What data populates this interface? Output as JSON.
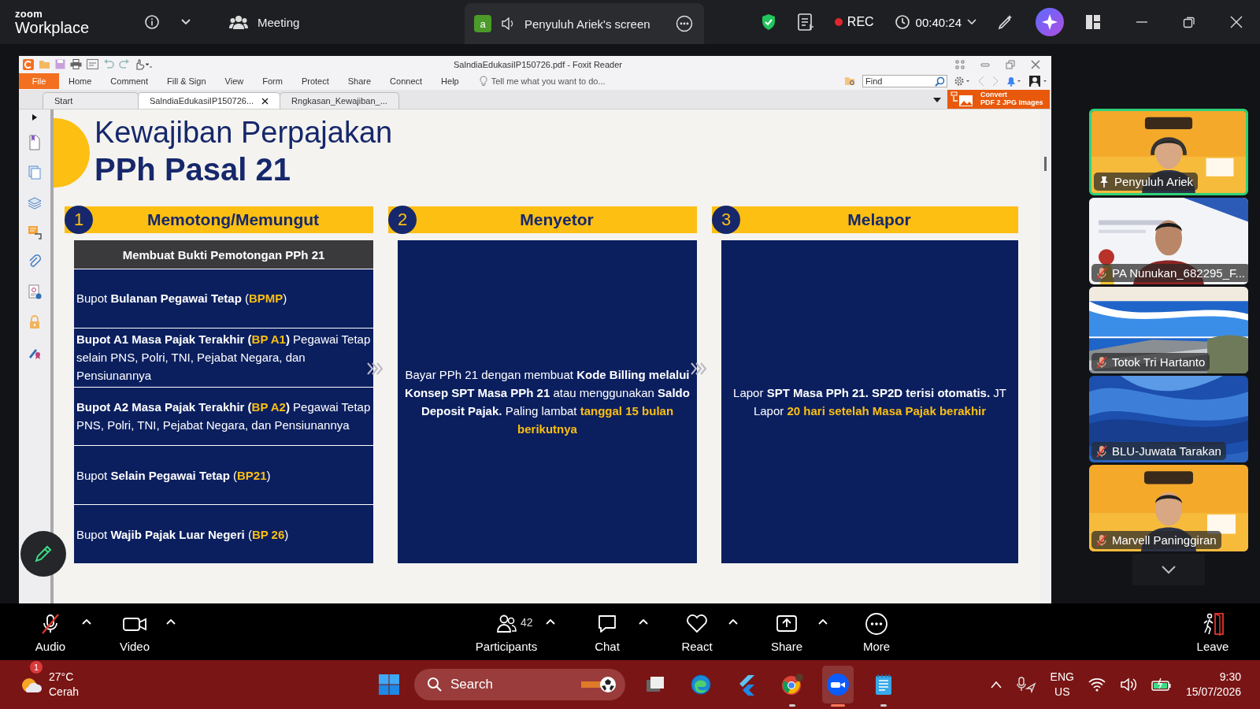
{
  "top_bar": {
    "brand_small": "zoom",
    "brand": "Workplace",
    "meeting_label": "Meeting",
    "share_tab": {
      "avatar": "a",
      "label": "Penyuluh Ariek's screen"
    },
    "rec_label": "REC",
    "timer": "00:40:24"
  },
  "reader": {
    "title": "SalndiaEdukasiIP150726.pdf - Foxit Reader",
    "menu": [
      {
        "label": "File",
        "selected": true
      },
      {
        "label": "Home",
        "selected": false
      },
      {
        "label": "Comment",
        "selected": false
      },
      {
        "label": "Fill & Sign",
        "selected": false
      },
      {
        "label": "View",
        "selected": false
      },
      {
        "label": "Form",
        "selected": false
      },
      {
        "label": "Protect",
        "selected": false
      },
      {
        "label": "Share",
        "selected": false
      },
      {
        "label": "Connect",
        "selected": false
      },
      {
        "label": "Help",
        "selected": false
      }
    ],
    "tell_me": "Tell me what you want to do...",
    "find": {
      "placeholder": "Find"
    },
    "convert": {
      "line1": "Convert",
      "line2": "PDF 2 JPG Images"
    },
    "tabs": [
      {
        "label": "Start",
        "selected": false,
        "closable": false
      },
      {
        "label": "SalndiaEdukasiIP150726...",
        "selected": true,
        "closable": true
      },
      {
        "label": "Rngkasan_Kewajiban_...",
        "selected": false,
        "closable": false
      }
    ]
  },
  "slide": {
    "title": "Kewajiban Perpajakan",
    "subtitle": "PPh Pasal 21",
    "columns": [
      {
        "number": "1",
        "heading": "Memotong/Memungut",
        "subheading": "Membuat Bukti Pemotongan PPh 21",
        "items": [
          [
            {
              "kind": "plain",
              "text": "Bupot "
            },
            {
              "kind": "bold",
              "text": "Bulanan Pegawai Tetap"
            },
            {
              "kind": "plain",
              "text": " ("
            },
            {
              "kind": "highlight",
              "text": "BPMP"
            },
            {
              "kind": "plain",
              "text": ")"
            }
          ],
          [
            {
              "kind": "bold",
              "text": "Bupot A1 Masa Pajak Terakhir ("
            },
            {
              "kind": "highlight",
              "text": "BP A1"
            },
            {
              "kind": "bold",
              "text": ")"
            },
            {
              "kind": "plain",
              "text": " Pegawai Tetap selain PNS, Polri, TNI, Pejabat Negara,  dan Pensiunannya"
            }
          ],
          [
            {
              "kind": "bold",
              "text": "Bupot A2 Masa Pajak Terakhir ("
            },
            {
              "kind": "highlight",
              "text": "BP A2"
            },
            {
              "kind": "bold",
              "text": ")"
            },
            {
              "kind": "plain",
              "text": " Pegawai Tetap PNS, Polri, TNI, Pejabat Negara, dan Pensiunannya"
            }
          ],
          [
            {
              "kind": "plain",
              "text": "Bupot "
            },
            {
              "kind": "bold",
              "text": "Selain Pegawai Tetap"
            },
            {
              "kind": "plain",
              "text": " ("
            },
            {
              "kind": "highlight",
              "text": "BP21"
            },
            {
              "kind": "plain",
              "text": ")"
            }
          ],
          [
            {
              "kind": "plain",
              "text": "Bupot "
            },
            {
              "kind": "bold",
              "text": "Wajib Pajak Luar Negeri"
            },
            {
              "kind": "plain",
              "text": " ("
            },
            {
              "kind": "highlight",
              "text": "BP 26"
            },
            {
              "kind": "plain",
              "text": ")"
            }
          ]
        ]
      },
      {
        "number": "2",
        "heading": "Menyetor",
        "body": [
          {
            "kind": "plain",
            "text": "Bayar PPh 21 dengan membuat "
          },
          {
            "kind": "bold",
            "text": "Kode Billing melalui Konsep SPT Masa PPh 21"
          },
          {
            "kind": "plain",
            "text": " atau menggunakan "
          },
          {
            "kind": "bold",
            "text": "Saldo Deposit Pajak."
          },
          {
            "kind": "plain",
            "text": "  Paling lambat "
          },
          {
            "kind": "highlight",
            "text": "tanggal 15 bulan berikutnya"
          }
        ]
      },
      {
        "number": "3",
        "heading": "Melapor",
        "body": [
          {
            "kind": "plain",
            "text": "Lapor "
          },
          {
            "kind": "bold",
            "text": "SPT Masa PPh 21. SP2D terisi otomatis."
          },
          {
            "kind": "plain",
            "text": " JT Lapor "
          },
          {
            "kind": "highlight",
            "text": "20 hari setelah Masa Pajak berakhir"
          }
        ]
      }
    ]
  },
  "participants": [
    {
      "name": "Penyuluh Ariek",
      "active": true,
      "pinned": true,
      "muted": false
    },
    {
      "name": "PA Nunukan_682295_F...",
      "active": false,
      "pinned": false,
      "muted": true
    },
    {
      "name": "Totok Tri Hartanto",
      "active": false,
      "pinned": false,
      "muted": true
    },
    {
      "name": "BLU-Juwata Tarakan",
      "active": false,
      "pinned": false,
      "muted": true
    },
    {
      "name": "Marvell Paninggiran",
      "active": false,
      "pinned": false,
      "muted": true
    }
  ],
  "toolbar": {
    "buttons": [
      {
        "kind": "audio",
        "label": "Audio",
        "muted": true,
        "caret": true
      },
      {
        "kind": "video",
        "label": "Video",
        "caret": true
      },
      {
        "kind": "participants",
        "label": "Participants",
        "count": "42",
        "caret": true
      },
      {
        "kind": "chat",
        "label": "Chat",
        "caret": true
      },
      {
        "kind": "react",
        "label": "React",
        "caret": true
      },
      {
        "kind": "share",
        "label": "Share",
        "caret": true
      },
      {
        "kind": "more",
        "label": "More",
        "caret": false
      }
    ],
    "leave_label": "Leave"
  },
  "taskbar": {
    "weather": {
      "badge": "1",
      "temperature": "27°C",
      "condition": "Cerah"
    },
    "search": {
      "placeholder": "Search"
    },
    "apps": [
      {
        "kind": "taskview",
        "running": false,
        "selected": false
      },
      {
        "kind": "edge",
        "running": false,
        "selected": false
      },
      {
        "kind": "flutter",
        "running": false,
        "selected": false
      },
      {
        "kind": "chrome",
        "running": true,
        "selected": false
      },
      {
        "kind": "zoom",
        "running": true,
        "selected": true
      },
      {
        "kind": "notepad",
        "running": true,
        "selected": false
      }
    ],
    "language": {
      "line1": "ENG",
      "line2": "US"
    },
    "time": "9:30",
    "date": "15/07/2026"
  }
}
